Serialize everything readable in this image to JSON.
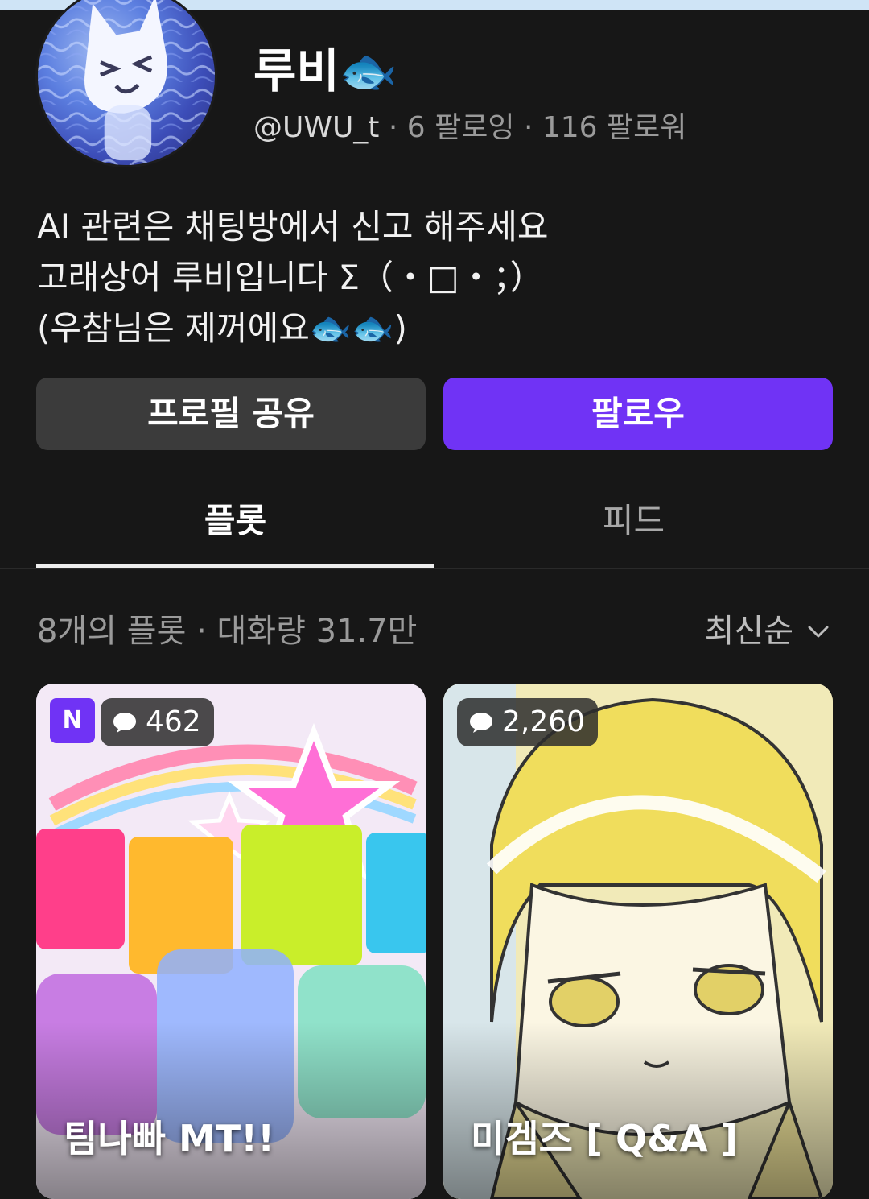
{
  "profile": {
    "name": "루비🐟",
    "handle": "@UWU_t",
    "following": "· 6 팔로잉",
    "followers": "· 116 팔로워",
    "bio": [
      "AI 관련은 채팅방에서 신고 해주세요",
      "고래상어 루비입니다 Σ（・□・；）",
      "(우참님은 제꺼에요🐟🐟)"
    ]
  },
  "actions": {
    "share_label": "프로필 공유",
    "follow_label": "팔로우",
    "follow_color": "#7033f5"
  },
  "tabs": [
    {
      "label": "플롯",
      "active": true
    },
    {
      "label": "피드",
      "active": false
    }
  ],
  "list_header": {
    "summary": "8개의 플롯 · 대화량 31.7만",
    "sort_label": "최신순",
    "sort_icon": "chevron-down-icon"
  },
  "plots": [
    {
      "badge": "N",
      "count": "462",
      "title": "팀나빠 MT!!"
    },
    {
      "count": "2,260",
      "title": "미겜즈 [ Q&A ]"
    }
  ],
  "icons": {
    "count_icon": "chat-bubble-icon"
  }
}
